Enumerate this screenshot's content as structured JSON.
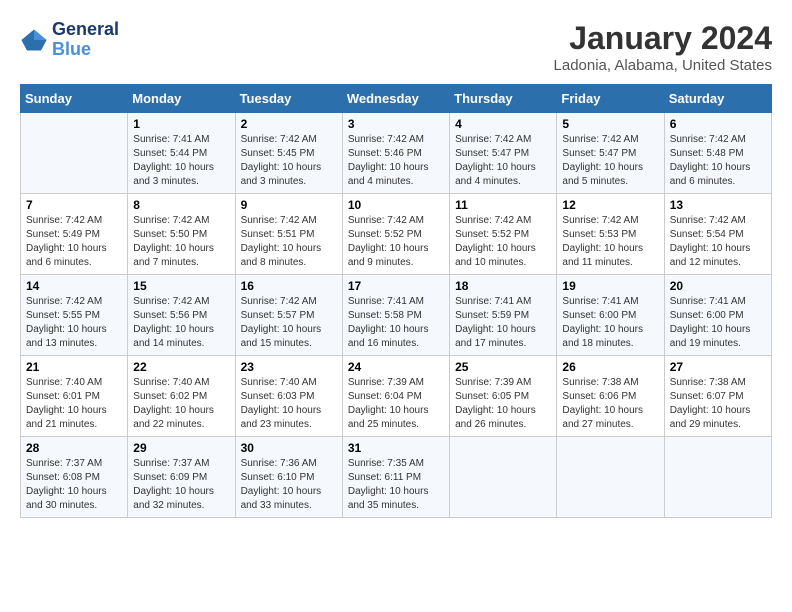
{
  "header": {
    "logo_line1": "General",
    "logo_line2": "Blue",
    "month_title": "January 2024",
    "location": "Ladonia, Alabama, United States"
  },
  "weekdays": [
    "Sunday",
    "Monday",
    "Tuesday",
    "Wednesday",
    "Thursday",
    "Friday",
    "Saturday"
  ],
  "weeks": [
    [
      {
        "day": "",
        "sunrise": "",
        "sunset": "",
        "daylight": ""
      },
      {
        "day": "1",
        "sunrise": "Sunrise: 7:41 AM",
        "sunset": "Sunset: 5:44 PM",
        "daylight": "Daylight: 10 hours and 3 minutes."
      },
      {
        "day": "2",
        "sunrise": "Sunrise: 7:42 AM",
        "sunset": "Sunset: 5:45 PM",
        "daylight": "Daylight: 10 hours and 3 minutes."
      },
      {
        "day": "3",
        "sunrise": "Sunrise: 7:42 AM",
        "sunset": "Sunset: 5:46 PM",
        "daylight": "Daylight: 10 hours and 4 minutes."
      },
      {
        "day": "4",
        "sunrise": "Sunrise: 7:42 AM",
        "sunset": "Sunset: 5:47 PM",
        "daylight": "Daylight: 10 hours and 4 minutes."
      },
      {
        "day": "5",
        "sunrise": "Sunrise: 7:42 AM",
        "sunset": "Sunset: 5:47 PM",
        "daylight": "Daylight: 10 hours and 5 minutes."
      },
      {
        "day": "6",
        "sunrise": "Sunrise: 7:42 AM",
        "sunset": "Sunset: 5:48 PM",
        "daylight": "Daylight: 10 hours and 6 minutes."
      }
    ],
    [
      {
        "day": "7",
        "sunrise": "Sunrise: 7:42 AM",
        "sunset": "Sunset: 5:49 PM",
        "daylight": "Daylight: 10 hours and 6 minutes."
      },
      {
        "day": "8",
        "sunrise": "Sunrise: 7:42 AM",
        "sunset": "Sunset: 5:50 PM",
        "daylight": "Daylight: 10 hours and 7 minutes."
      },
      {
        "day": "9",
        "sunrise": "Sunrise: 7:42 AM",
        "sunset": "Sunset: 5:51 PM",
        "daylight": "Daylight: 10 hours and 8 minutes."
      },
      {
        "day": "10",
        "sunrise": "Sunrise: 7:42 AM",
        "sunset": "Sunset: 5:52 PM",
        "daylight": "Daylight: 10 hours and 9 minutes."
      },
      {
        "day": "11",
        "sunrise": "Sunrise: 7:42 AM",
        "sunset": "Sunset: 5:52 PM",
        "daylight": "Daylight: 10 hours and 10 minutes."
      },
      {
        "day": "12",
        "sunrise": "Sunrise: 7:42 AM",
        "sunset": "Sunset: 5:53 PM",
        "daylight": "Daylight: 10 hours and 11 minutes."
      },
      {
        "day": "13",
        "sunrise": "Sunrise: 7:42 AM",
        "sunset": "Sunset: 5:54 PM",
        "daylight": "Daylight: 10 hours and 12 minutes."
      }
    ],
    [
      {
        "day": "14",
        "sunrise": "Sunrise: 7:42 AM",
        "sunset": "Sunset: 5:55 PM",
        "daylight": "Daylight: 10 hours and 13 minutes."
      },
      {
        "day": "15",
        "sunrise": "Sunrise: 7:42 AM",
        "sunset": "Sunset: 5:56 PM",
        "daylight": "Daylight: 10 hours and 14 minutes."
      },
      {
        "day": "16",
        "sunrise": "Sunrise: 7:42 AM",
        "sunset": "Sunset: 5:57 PM",
        "daylight": "Daylight: 10 hours and 15 minutes."
      },
      {
        "day": "17",
        "sunrise": "Sunrise: 7:41 AM",
        "sunset": "Sunset: 5:58 PM",
        "daylight": "Daylight: 10 hours and 16 minutes."
      },
      {
        "day": "18",
        "sunrise": "Sunrise: 7:41 AM",
        "sunset": "Sunset: 5:59 PM",
        "daylight": "Daylight: 10 hours and 17 minutes."
      },
      {
        "day": "19",
        "sunrise": "Sunrise: 7:41 AM",
        "sunset": "Sunset: 6:00 PM",
        "daylight": "Daylight: 10 hours and 18 minutes."
      },
      {
        "day": "20",
        "sunrise": "Sunrise: 7:41 AM",
        "sunset": "Sunset: 6:00 PM",
        "daylight": "Daylight: 10 hours and 19 minutes."
      }
    ],
    [
      {
        "day": "21",
        "sunrise": "Sunrise: 7:40 AM",
        "sunset": "Sunset: 6:01 PM",
        "daylight": "Daylight: 10 hours and 21 minutes."
      },
      {
        "day": "22",
        "sunrise": "Sunrise: 7:40 AM",
        "sunset": "Sunset: 6:02 PM",
        "daylight": "Daylight: 10 hours and 22 minutes."
      },
      {
        "day": "23",
        "sunrise": "Sunrise: 7:40 AM",
        "sunset": "Sunset: 6:03 PM",
        "daylight": "Daylight: 10 hours and 23 minutes."
      },
      {
        "day": "24",
        "sunrise": "Sunrise: 7:39 AM",
        "sunset": "Sunset: 6:04 PM",
        "daylight": "Daylight: 10 hours and 25 minutes."
      },
      {
        "day": "25",
        "sunrise": "Sunrise: 7:39 AM",
        "sunset": "Sunset: 6:05 PM",
        "daylight": "Daylight: 10 hours and 26 minutes."
      },
      {
        "day": "26",
        "sunrise": "Sunrise: 7:38 AM",
        "sunset": "Sunset: 6:06 PM",
        "daylight": "Daylight: 10 hours and 27 minutes."
      },
      {
        "day": "27",
        "sunrise": "Sunrise: 7:38 AM",
        "sunset": "Sunset: 6:07 PM",
        "daylight": "Daylight: 10 hours and 29 minutes."
      }
    ],
    [
      {
        "day": "28",
        "sunrise": "Sunrise: 7:37 AM",
        "sunset": "Sunset: 6:08 PM",
        "daylight": "Daylight: 10 hours and 30 minutes."
      },
      {
        "day": "29",
        "sunrise": "Sunrise: 7:37 AM",
        "sunset": "Sunset: 6:09 PM",
        "daylight": "Daylight: 10 hours and 32 minutes."
      },
      {
        "day": "30",
        "sunrise": "Sunrise: 7:36 AM",
        "sunset": "Sunset: 6:10 PM",
        "daylight": "Daylight: 10 hours and 33 minutes."
      },
      {
        "day": "31",
        "sunrise": "Sunrise: 7:35 AM",
        "sunset": "Sunset: 6:11 PM",
        "daylight": "Daylight: 10 hours and 35 minutes."
      },
      {
        "day": "",
        "sunrise": "",
        "sunset": "",
        "daylight": ""
      },
      {
        "day": "",
        "sunrise": "",
        "sunset": "",
        "daylight": ""
      },
      {
        "day": "",
        "sunrise": "",
        "sunset": "",
        "daylight": ""
      }
    ]
  ]
}
